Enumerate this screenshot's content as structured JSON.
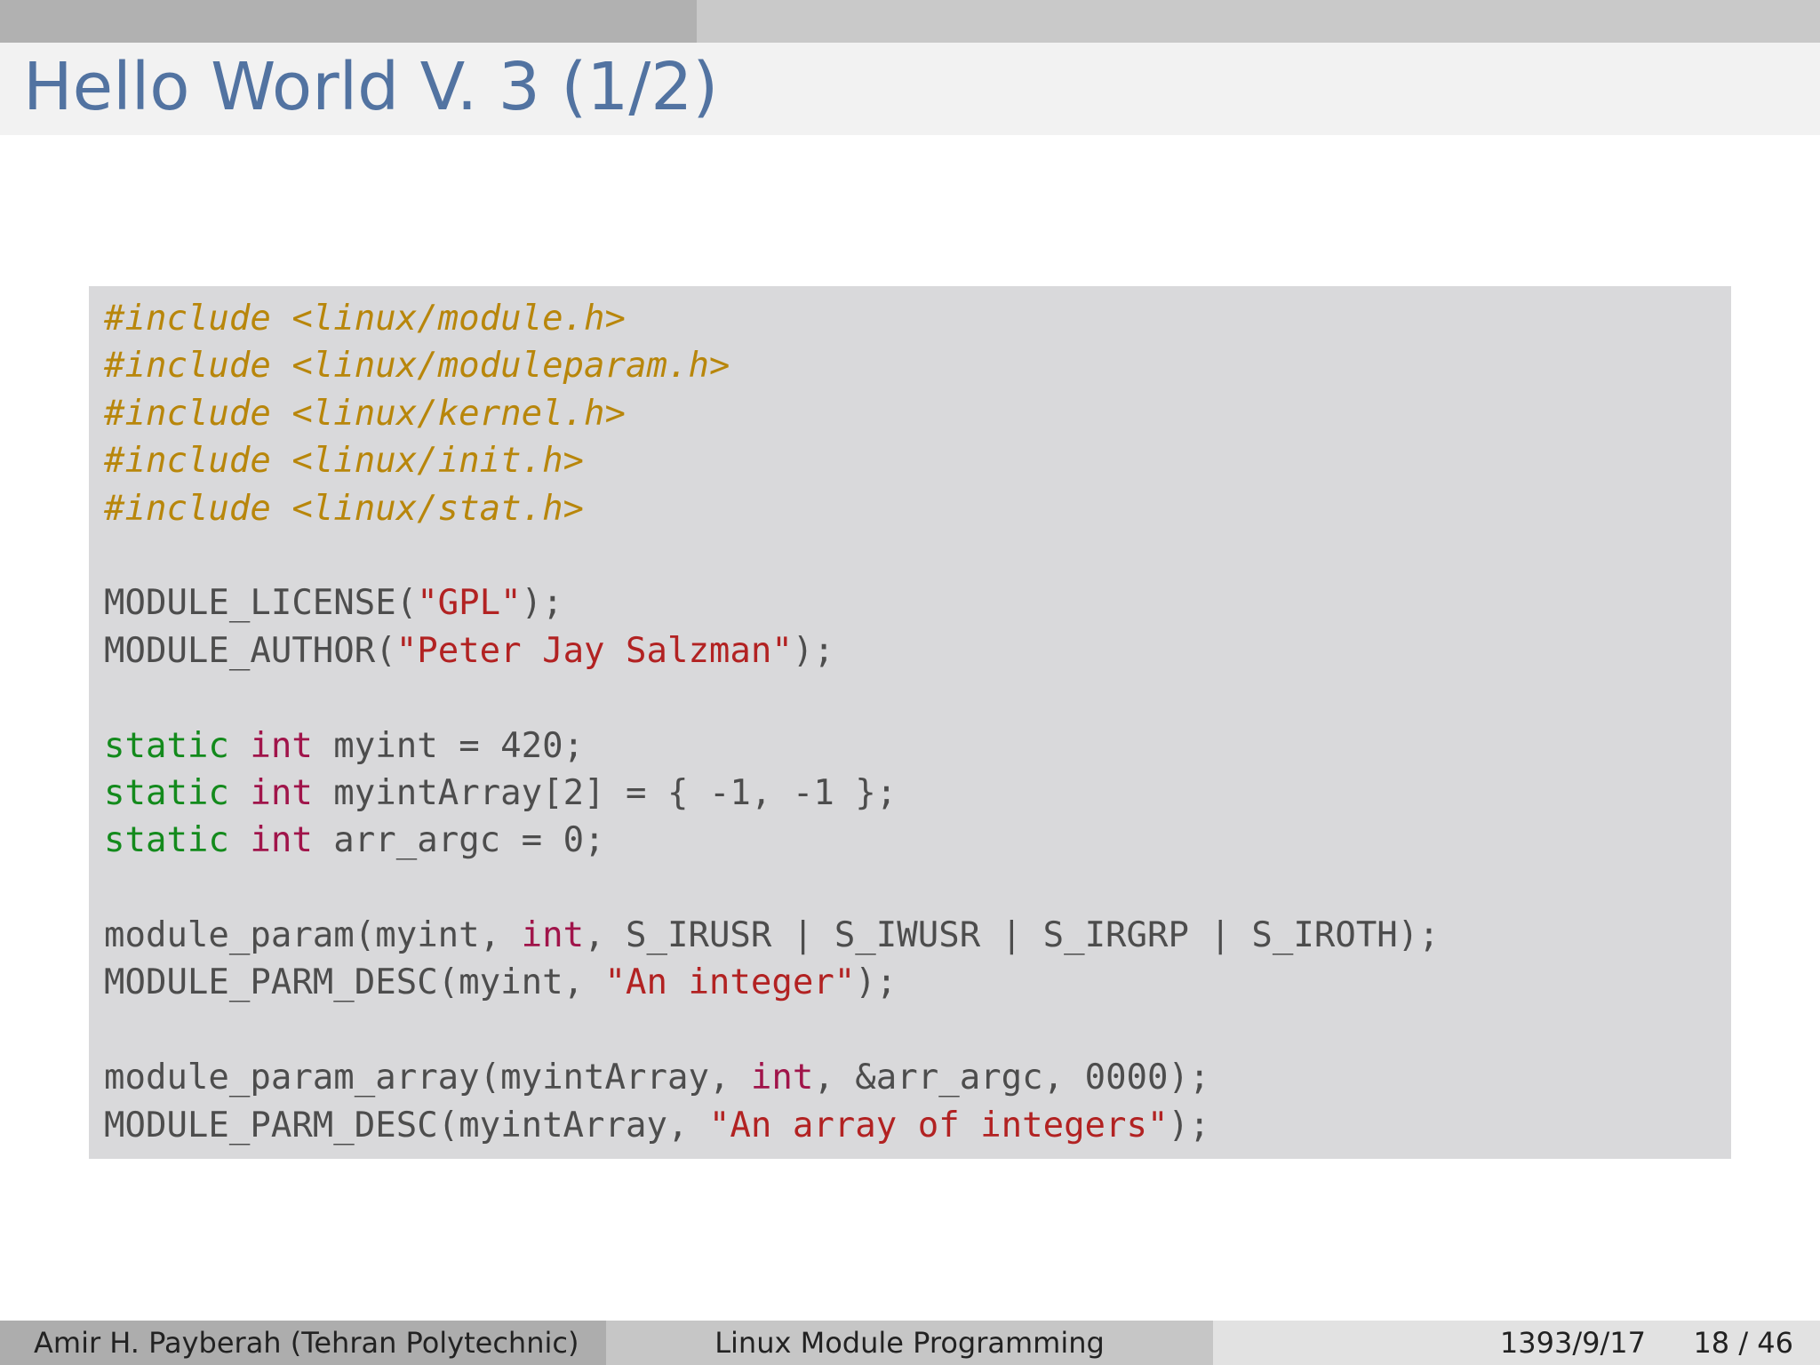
{
  "progress": {
    "fraction": 0.383
  },
  "slide": {
    "title": "Hello World V. 3 (1/2)"
  },
  "code": {
    "lines": [
      [
        {
          "t": "#include <linux/module.h>",
          "c": "pre"
        }
      ],
      [
        {
          "t": "#include <linux/moduleparam.h>",
          "c": "pre"
        }
      ],
      [
        {
          "t": "#include <linux/kernel.h>",
          "c": "pre"
        }
      ],
      [
        {
          "t": "#include <linux/init.h>",
          "c": "pre"
        }
      ],
      [
        {
          "t": "#include <linux/stat.h>",
          "c": "pre"
        }
      ],
      [],
      [
        {
          "t": "MODULE_LICENSE(",
          "c": ""
        },
        {
          "t": "\"GPL\"",
          "c": "str"
        },
        {
          "t": ");",
          "c": ""
        }
      ],
      [
        {
          "t": "MODULE_AUTHOR(",
          "c": ""
        },
        {
          "t": "\"Peter Jay Salzman\"",
          "c": "str"
        },
        {
          "t": ");",
          "c": ""
        }
      ],
      [],
      [
        {
          "t": "static",
          "c": "kw"
        },
        {
          "t": " ",
          "c": ""
        },
        {
          "t": "int",
          "c": "type"
        },
        {
          "t": " myint = 420;",
          "c": ""
        }
      ],
      [
        {
          "t": "static",
          "c": "kw"
        },
        {
          "t": " ",
          "c": ""
        },
        {
          "t": "int",
          "c": "type"
        },
        {
          "t": " myintArray[2] = { -1, -1 };",
          "c": ""
        }
      ],
      [
        {
          "t": "static",
          "c": "kw"
        },
        {
          "t": " ",
          "c": ""
        },
        {
          "t": "int",
          "c": "type"
        },
        {
          "t": " arr_argc = 0;",
          "c": ""
        }
      ],
      [],
      [
        {
          "t": "module_param(myint, ",
          "c": ""
        },
        {
          "t": "int",
          "c": "type"
        },
        {
          "t": ", S_IRUSR | S_IWUSR | S_IRGRP | S_IROTH);",
          "c": ""
        }
      ],
      [
        {
          "t": "MODULE_PARM_DESC(myint, ",
          "c": ""
        },
        {
          "t": "\"An integer\"",
          "c": "str"
        },
        {
          "t": ");",
          "c": ""
        }
      ],
      [],
      [
        {
          "t": "module_param_array(myintArray, ",
          "c": ""
        },
        {
          "t": "int",
          "c": "type"
        },
        {
          "t": ", &arr_argc, 0000);",
          "c": ""
        }
      ],
      [
        {
          "t": "MODULE_PARM_DESC(myintArray, ",
          "c": ""
        },
        {
          "t": "\"An array of integers\"",
          "c": "str"
        },
        {
          "t": ");",
          "c": ""
        }
      ]
    ]
  },
  "footer": {
    "author": "Amir H. Payberah  (Tehran Polytechnic)",
    "course": "Linux Module Programming",
    "date": "1393/9/17",
    "page": "18 / 46"
  },
  "colors": {
    "title": "#5273a1",
    "preprocessor": "#b8860b",
    "string": "#b22222",
    "keyword": "#138a1c",
    "type": "#a0144a",
    "code_text": "#4d4d4d",
    "code_background": "#d9d9db"
  }
}
